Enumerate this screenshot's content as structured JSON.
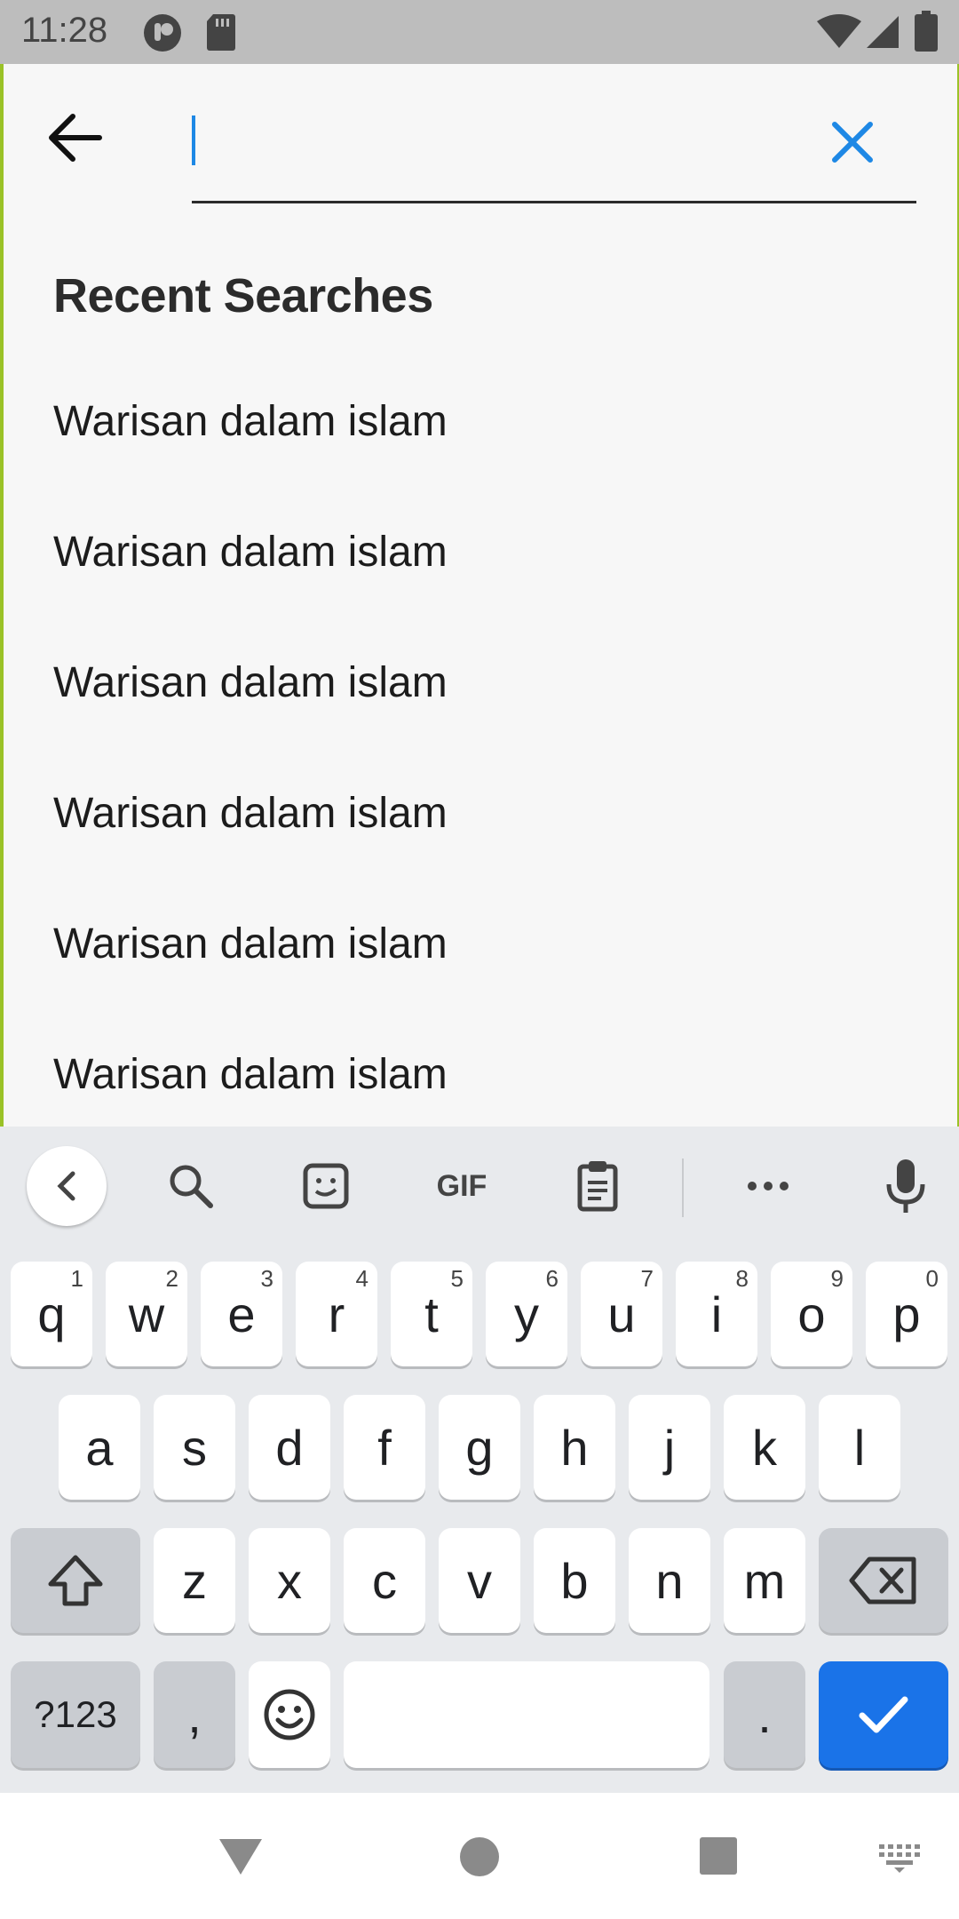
{
  "status_bar": {
    "time": "11:28"
  },
  "search": {
    "value": "",
    "placeholder": ""
  },
  "recent": {
    "title": "Recent Searches",
    "items": [
      "Warisan dalam islam",
      "Warisan dalam islam",
      "Warisan dalam islam",
      "Warisan dalam islam",
      "Warisan dalam islam",
      "Warisan dalam islam"
    ]
  },
  "keyboard": {
    "toolbar": {
      "gif_label": "GIF"
    },
    "row1": [
      {
        "k": "q",
        "h": "1"
      },
      {
        "k": "w",
        "h": "2"
      },
      {
        "k": "e",
        "h": "3"
      },
      {
        "k": "r",
        "h": "4"
      },
      {
        "k": "t",
        "h": "5"
      },
      {
        "k": "y",
        "h": "6"
      },
      {
        "k": "u",
        "h": "7"
      },
      {
        "k": "i",
        "h": "8"
      },
      {
        "k": "o",
        "h": "9"
      },
      {
        "k": "p",
        "h": "0"
      }
    ],
    "row2": [
      "a",
      "s",
      "d",
      "f",
      "g",
      "h",
      "j",
      "k",
      "l"
    ],
    "row3": [
      "z",
      "x",
      "c",
      "v",
      "b",
      "n",
      "m"
    ],
    "symbols_label": "?123",
    "comma_label": ",",
    "period_label": "."
  },
  "colors": {
    "accent": "#1e88e5",
    "enter_key": "#1a73e8",
    "border_accent": "#9ac227"
  }
}
